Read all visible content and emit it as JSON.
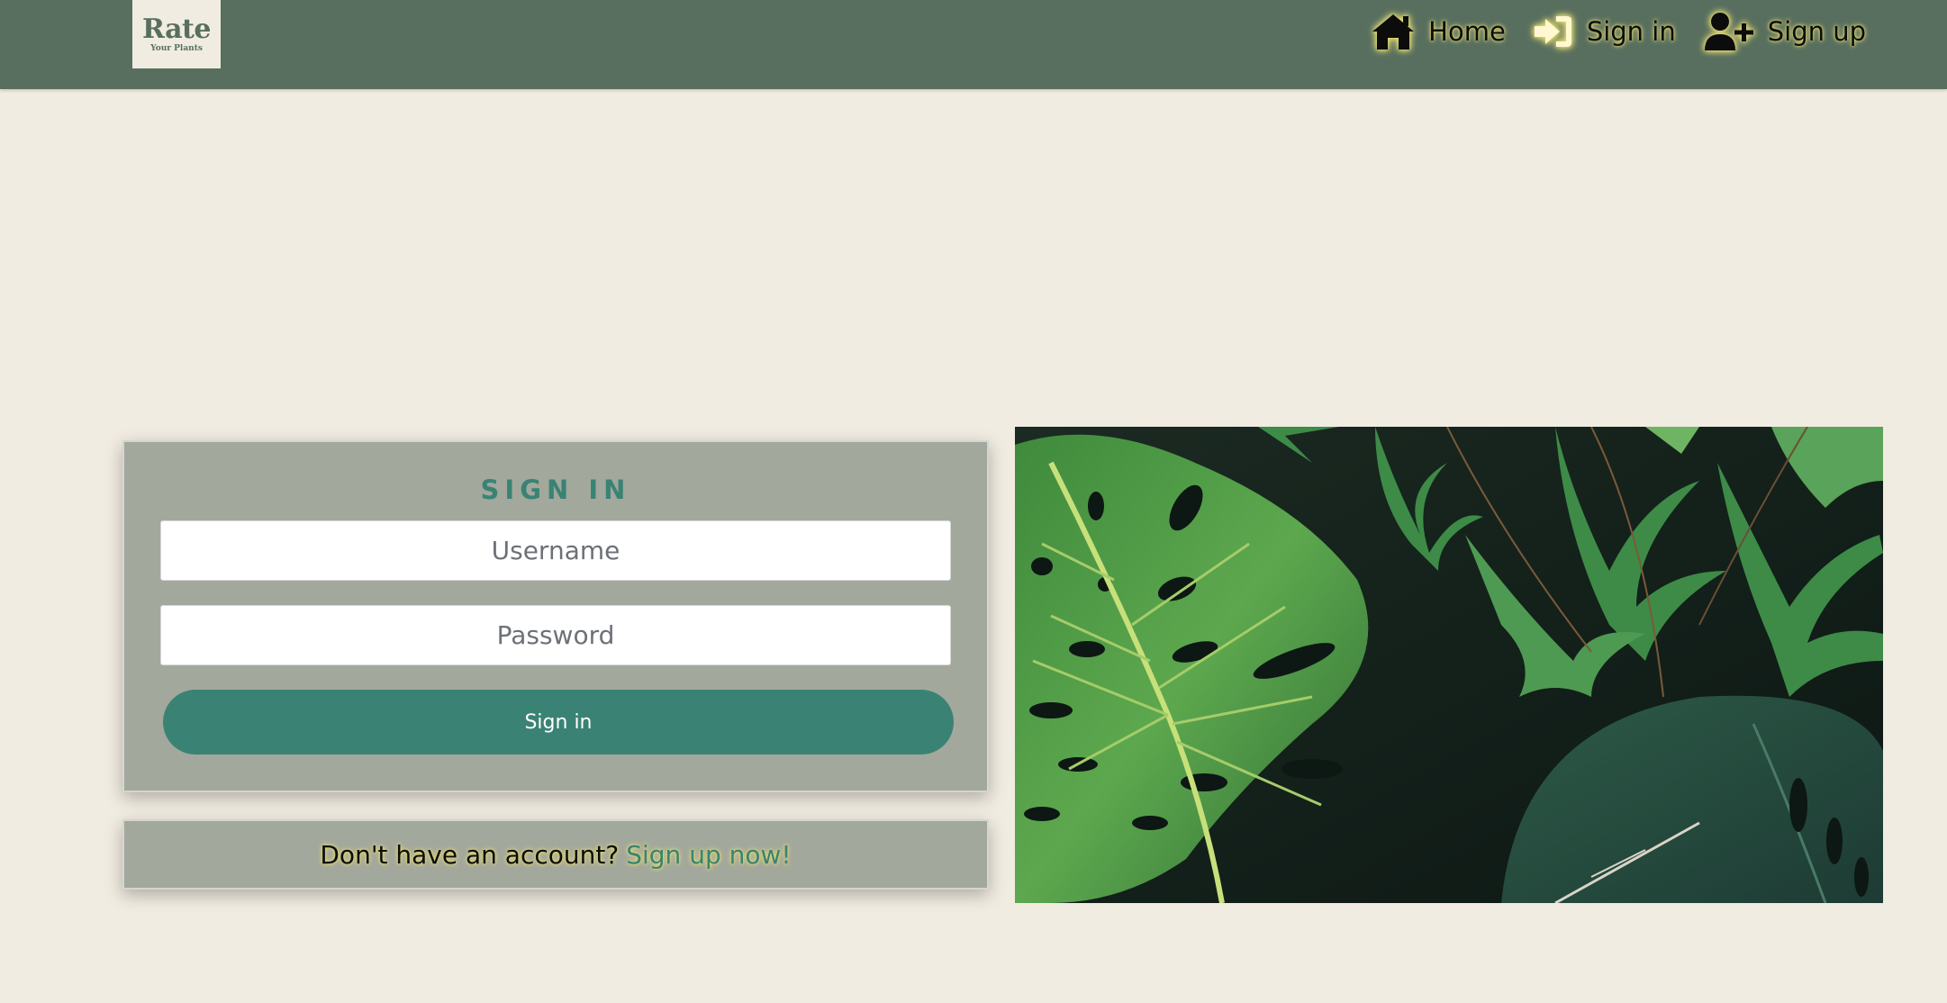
{
  "brand": {
    "logo_main": "Rate",
    "logo_sub": "Your Plants"
  },
  "nav": {
    "items": [
      {
        "label": "Home",
        "icon": "home-icon"
      },
      {
        "label": "Sign in",
        "icon": "sign-in-icon"
      },
      {
        "label": "Sign up",
        "icon": "user-plus-icon"
      }
    ]
  },
  "signin": {
    "title": "SIGN IN",
    "username_placeholder": "Username",
    "password_placeholder": "Password",
    "button_label": "Sign in"
  },
  "signup": {
    "prompt": "Don't have an account?",
    "link_label": "Sign up now!"
  },
  "colors": {
    "header": "#586f5f",
    "background": "#f1ece1",
    "card": "#a3a89c",
    "accent": "#3a8374",
    "glow": "#e6dd72"
  }
}
